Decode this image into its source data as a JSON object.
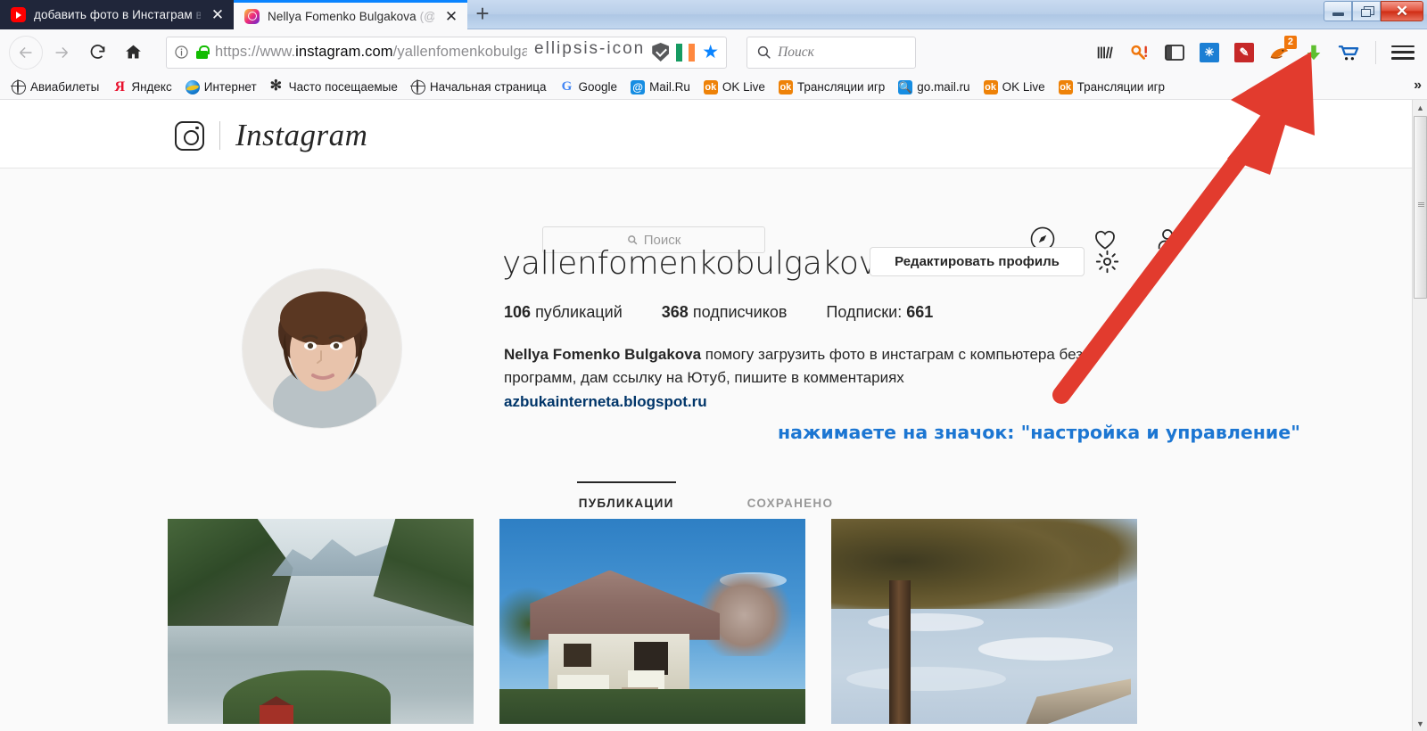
{
  "browser": {
    "tabs": [
      {
        "title": "добавить фото в Инстаграм",
        "title_dim": " в",
        "favicon": "youtube-icon",
        "active": false,
        "close_label": "✕"
      },
      {
        "title": "Nellya Fomenko Bulgakova",
        "title_dim": " (@…",
        "favicon": "instagram-icon",
        "active": true,
        "close_label": "✕"
      }
    ],
    "newtab_label": "+",
    "window_controls": {
      "minimize": "minimize-icon",
      "maximize": "maximize-icon",
      "close": "✕"
    },
    "nav": {
      "back": "back-arrow-icon",
      "forward": "forward-arrow-icon",
      "reload": "reload-icon",
      "home": "home-icon"
    },
    "urlbar": {
      "identity_icon": "info-icon",
      "lock_icon": "lock-icon",
      "scheme": "https://www.",
      "host": "instagram.com",
      "path": "/yallenfomenkobulgakova/",
      "page_actions": "ellipsis-icon",
      "shield_icon": "shield-icon",
      "flag_icon": "ireland-flag-icon",
      "bookmark_icon": "star-icon"
    },
    "search": {
      "placeholder": "Поиск",
      "icon": "search-icon"
    },
    "toolbar_icons": [
      {
        "name": "library-icon",
        "label": "|||\\"
      },
      {
        "name": "key-alert-icon",
        "label": ""
      },
      {
        "name": "sidebar-icon",
        "label": ""
      },
      {
        "name": "sparkle-icon",
        "label": "✳"
      },
      {
        "name": "magic-wand-icon",
        "label": "✎"
      },
      {
        "name": "firefox-addon-icon",
        "label": "",
        "badge": "2"
      },
      {
        "name": "download-icon",
        "label": "⬇"
      },
      {
        "name": "cart-icon",
        "label": ""
      },
      {
        "name": "hamburger-menu-icon",
        "label": ""
      }
    ],
    "bookmarks": [
      {
        "label": "Авиабилеты",
        "icon": "globe-icon"
      },
      {
        "label": "Яндекс",
        "icon": "yandex-icon"
      },
      {
        "label": "Интернет",
        "icon": "internet-explorer-icon"
      },
      {
        "label": "Часто посещаемые",
        "icon": "gear-icon"
      },
      {
        "label": "Начальная страница",
        "icon": "globe-icon"
      },
      {
        "label": "Google",
        "icon": "google-icon"
      },
      {
        "label": "Mail.Ru",
        "icon": "mailru-icon"
      },
      {
        "label": "OK Live",
        "icon": "odnoklassniki-icon"
      },
      {
        "label": "Трансляции игр",
        "icon": "odnoklassniki-icon"
      },
      {
        "label": "go.mail.ru",
        "icon": "mailru-search-icon"
      },
      {
        "label": "OK Live",
        "icon": "odnoklassniki-icon"
      },
      {
        "label": "Трансляции игр",
        "icon": "odnoklassniki-icon"
      }
    ],
    "bookmarks_overflow": "»"
  },
  "instagram": {
    "logo": {
      "wordmark": "Instagram",
      "camera_icon": "instagram-camera-icon"
    },
    "search": {
      "placeholder": "Поиск",
      "icon": "search-icon"
    },
    "nav_icons": [
      {
        "name": "compass-icon"
      },
      {
        "name": "heart-icon"
      },
      {
        "name": "profile-person-icon"
      }
    ],
    "profile": {
      "username": "yallenfomenkobulgakova",
      "edit_button": "Редактировать профиль",
      "settings_icon": "gear-icon",
      "avatar_alt": "avatar",
      "stats": [
        {
          "value": "106",
          "label": "публикаций"
        },
        {
          "value": "368",
          "label": "подписчиков"
        },
        {
          "label": "Подписки:",
          "value": "661",
          "value_first": false
        }
      ],
      "full_name": "Nellya Fomenko Bulgakova",
      "bio_line1": " помогу загрузить фото в инстаграм с компьютера без",
      "bio_line2": "программ, дам ссылку на Ютуб, пишите в комментариях",
      "bio_link": "azbukainterneta.blogspot.ru"
    },
    "tabs": [
      {
        "label": "ПУБЛИКАЦИИ",
        "active": true
      },
      {
        "label": "СОХРАНЕНО",
        "active": false
      }
    ],
    "grid": [
      {
        "name": "post-fjord-landscape"
      },
      {
        "name": "post-thatched-house"
      },
      {
        "name": "post-tree-and-dock"
      }
    ]
  },
  "annotation": {
    "text": "нажимаете на значок: \"настройка и управление\"",
    "color": "#1c76d2",
    "arrow": {
      "name": "red-pointer-arrow",
      "color": "#e23b2e",
      "points_to": "hamburger-menu-icon"
    }
  },
  "scrollbar": {
    "up": "▲",
    "down": "▼"
  }
}
